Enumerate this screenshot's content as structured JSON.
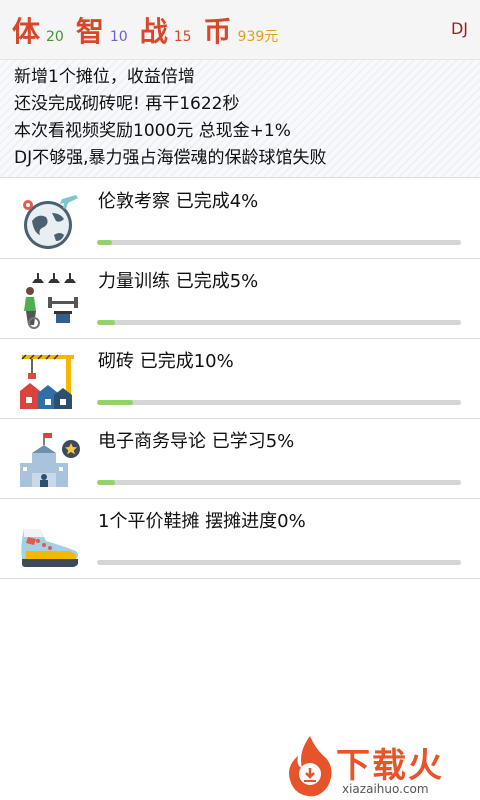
{
  "header": {
    "stats": [
      {
        "char": "体",
        "value": "20",
        "char_color": "#d9472b",
        "value_color": "#3a9a3a"
      },
      {
        "char": "智",
        "value": "10",
        "char_color": "#d9472b",
        "value_color": "#6b62c6"
      },
      {
        "char": "战",
        "value": "15",
        "char_color": "#d9472b",
        "value_color": "#d9472b"
      },
      {
        "char": "币",
        "value": "939元",
        "char_color": "#d9472b",
        "value_color": "#e79b1f"
      }
    ],
    "user": "DJ"
  },
  "messages": [
    "新增1个摊位，收益倍增",
    "还没完成砌砖呢! 再干1622秒",
    "本次看视频奖励1000元 总现金+1%",
    "DJ不够强,暴力强占海偿魂的保龄球馆失败"
  ],
  "tasks": [
    {
      "title": "伦敦考察 已完成4%",
      "progress": 0.04,
      "icon": "globe-travel-icon"
    },
    {
      "title": "力量训练 已完成5%",
      "progress": 0.05,
      "icon": "gym-training-icon"
    },
    {
      "title": "砌砖 已完成10%",
      "progress": 0.1,
      "icon": "construction-crane-icon"
    },
    {
      "title": "电子商务导论 已学习5%",
      "progress": 0.05,
      "icon": "school-icon"
    },
    {
      "title": "1个平价鞋摊 摆摊进度0%",
      "progress": 0.0,
      "icon": "sneaker-icon"
    }
  ],
  "watermark": {
    "text": "下载火",
    "sub": "xiazaihuo.com"
  }
}
